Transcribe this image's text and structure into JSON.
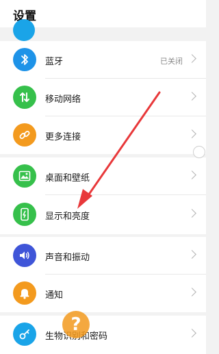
{
  "header": {
    "title": "设置"
  },
  "colors": {
    "top_partial": "#1aa4e8",
    "bluetooth": "#1e93e8",
    "mobile_network": "#36c04b",
    "more_connections": "#f39a1e",
    "wallpaper": "#36c04b",
    "display": "#36c04b",
    "sound": "#3f55d8",
    "notification": "#f39a1e",
    "biometrics": "#1aa4e8",
    "arrow": "#e8383a"
  },
  "rows": {
    "bluetooth": {
      "label": "蓝牙",
      "value": "已关闭",
      "icon": "bluetooth-icon"
    },
    "mobile_network": {
      "label": "移动网络",
      "icon": "mobile-data-icon"
    },
    "more_connections": {
      "label": "更多连接",
      "icon": "link-icon"
    },
    "wallpaper": {
      "label": "桌面和壁纸",
      "icon": "image-icon"
    },
    "display": {
      "label": "显示和亮度",
      "icon": "brightness-icon"
    },
    "sound": {
      "label": "声音和振动",
      "icon": "speaker-icon"
    },
    "notification": {
      "label": "通知",
      "icon": "bell-icon"
    },
    "biometrics": {
      "label": "生物识别和密码",
      "icon": "key-icon"
    }
  },
  "overlay": {
    "help_symbol": "?"
  }
}
